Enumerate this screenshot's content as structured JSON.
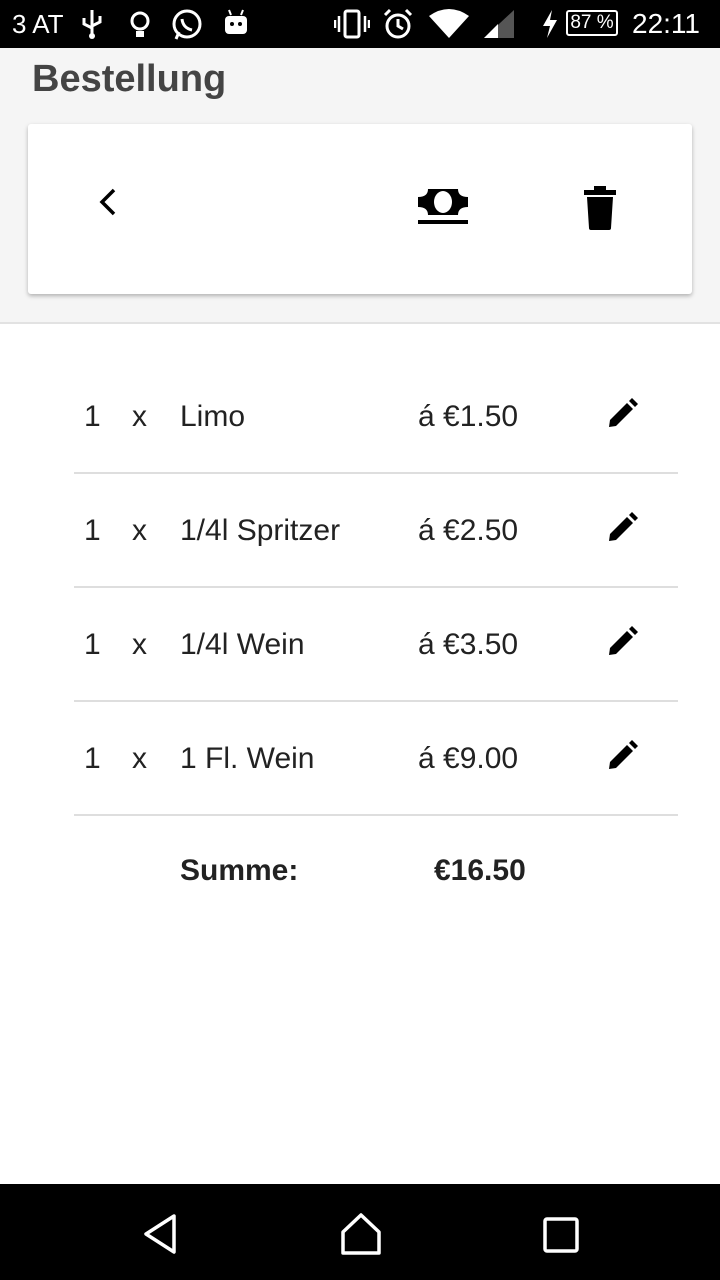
{
  "status_bar": {
    "carrier": "3 AT",
    "battery": "87 %",
    "time": "22:11"
  },
  "page": {
    "title": "Bestellung"
  },
  "toolbar": {
    "icons": [
      "back-icon",
      "cash-icon",
      "trash-icon"
    ]
  },
  "order": {
    "times_symbol": "x",
    "items": [
      {
        "qty": "1",
        "name": "Limo",
        "price": "á €1.50"
      },
      {
        "qty": "1",
        "name": "1/4l Spritzer",
        "price": "á €2.50"
      },
      {
        "qty": "1",
        "name": "1/4l Wein",
        "price": "á €3.50"
      },
      {
        "qty": "1",
        "name": "1 Fl. Wein",
        "price": "á €9.00"
      }
    ],
    "total_label": "Summe:",
    "total_value": "€16.50"
  },
  "navigation": {
    "icons": [
      "back-triangle-icon",
      "home-icon",
      "recents-icon"
    ]
  }
}
